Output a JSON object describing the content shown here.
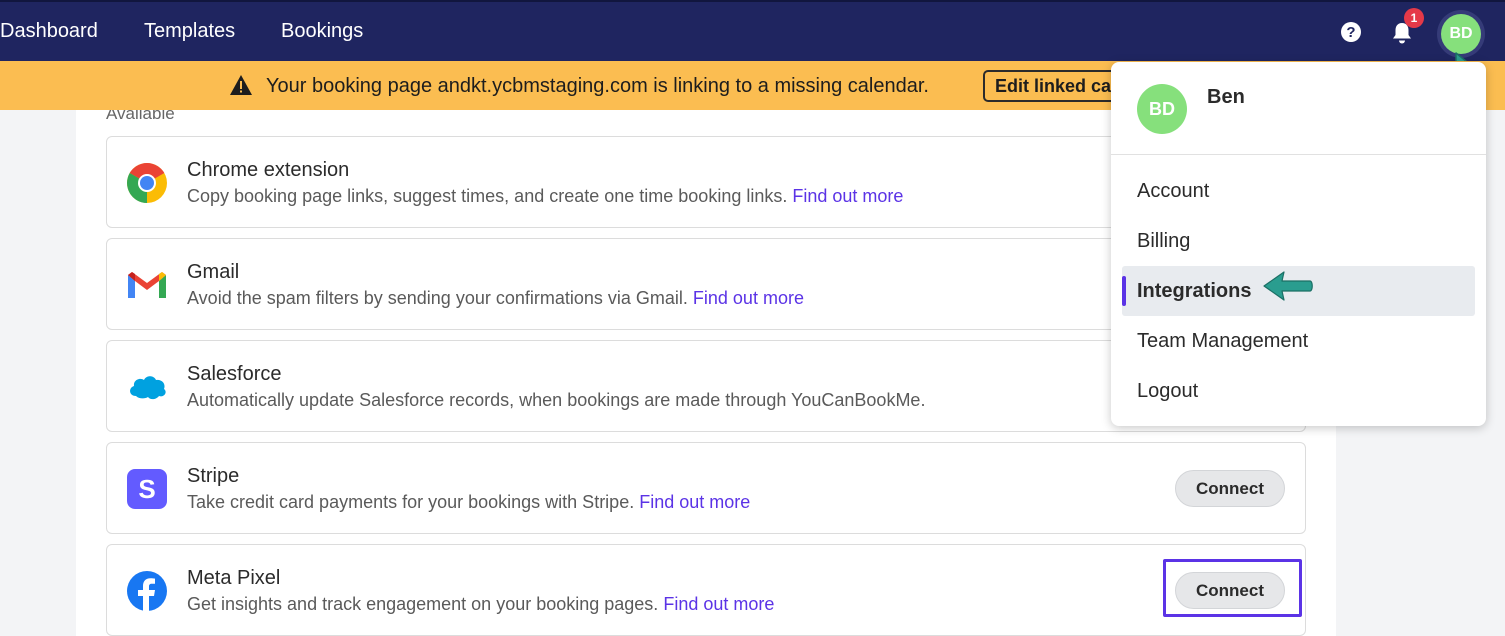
{
  "nav": {
    "dashboard": "Dashboard",
    "templates": "Templates",
    "bookings": "Bookings",
    "notification_count": "1",
    "avatar_initials": "BD",
    "icons": [
      "help-icon",
      "bell-icon"
    ]
  },
  "banner": {
    "message": "Your booking page andkt.ycbmstaging.com is linking to a missing calendar.",
    "button_label": "Edit linked calendars"
  },
  "section": {
    "label": "Available"
  },
  "integrations": [
    {
      "title": "Chrome extension",
      "description": "Copy booking page links, suggest times, and create one time booking links.",
      "link": "Find out more",
      "icon": "chrome-icon"
    },
    {
      "title": "Gmail",
      "description": "Avoid the spam filters by sending your confirmations via Gmail.",
      "link": "Find out more",
      "icon": "gmail-icon"
    },
    {
      "title": "Salesforce",
      "description": "Automatically update Salesforce records, when bookings are made through YouCanBookMe.",
      "link": "",
      "icon": "salesforce-icon"
    },
    {
      "title": "Stripe",
      "description": "Take credit card payments for your bookings with Stripe.",
      "link": "Find out more",
      "icon": "stripe-icon",
      "button": "Connect"
    },
    {
      "title": "Meta Pixel",
      "description": "Get insights and track engagement on your booking pages.",
      "link": "Find out more",
      "icon": "facebook-icon",
      "button": "Connect"
    }
  ],
  "dropdown": {
    "avatar_initials": "BD",
    "name": "Ben",
    "items": [
      "Account",
      "Billing",
      "Integrations",
      "Team Management",
      "Logout"
    ],
    "active_item": "Integrations"
  },
  "colors": {
    "nav_bg": "#1f2560",
    "banner_bg": "#fbbd51",
    "accent": "#5b33e6",
    "avatar_green": "#86e07c",
    "annotation_arrow": "#2a9d8f"
  }
}
